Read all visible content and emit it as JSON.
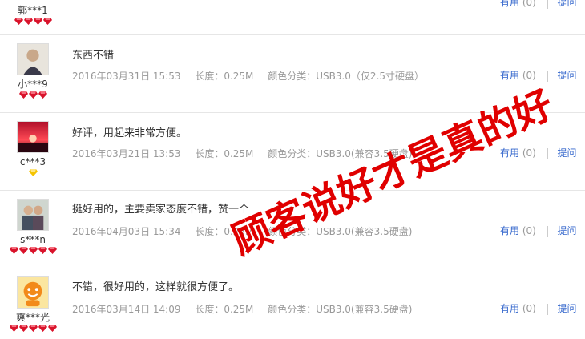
{
  "actions": {
    "useful_label": "有用",
    "ask_label": "提问"
  },
  "reviews": [
    {
      "user": "郭***1",
      "gems": 4,
      "count": "(0)",
      "content": "",
      "date": "",
      "length": "",
      "variant": ""
    },
    {
      "user": "小***9",
      "gems": 3,
      "count": "(0)",
      "content": "东西不错",
      "date": "2016年03月31日 15:53",
      "length": "长度：0.25M",
      "variant": "颜色分类：USB3.0（仅2.5寸硬盘）"
    },
    {
      "user": "c***3",
      "gems": 1,
      "count": "(0)",
      "content": "好评，用起来非常方便。",
      "date": "2016年03月21日 13:53",
      "length": "长度：0.25M",
      "variant": "颜色分类：USB3.0(兼容3.5硬盘)"
    },
    {
      "user": "s***n",
      "gems": 5,
      "count": "(0)",
      "content": "挺好用的，主要卖家态度不错，赞一个",
      "date": "2016年04月03日 15:34",
      "length": "长度：0.25M",
      "variant": "颜色分类：USB3.0(兼容3.5硬盘)"
    },
    {
      "user": "爽***光",
      "gems": 5,
      "count": "(0)",
      "content": "不错，很好用的，这样就很方便了。",
      "date": "2016年03月14日 14:09",
      "length": "长度：0.25M",
      "variant": "颜色分类：USB3.0(兼容3.5硬盘)"
    }
  ],
  "watermark": {
    "text": "顾客说好才是真的好",
    "color": "#e00000"
  },
  "colors": {
    "link": "#3366cc",
    "gem_red": "#d9132b",
    "gem_yellow": "#f5c400"
  }
}
